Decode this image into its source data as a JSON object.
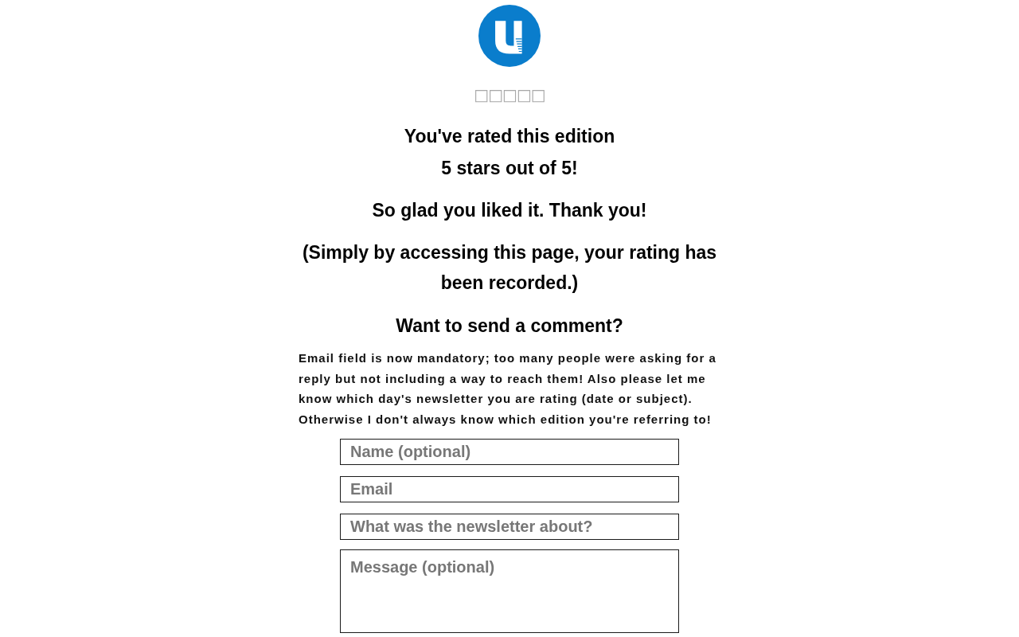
{
  "rating_marks": "□□□□□",
  "confirmation": {
    "title": "You've rated this edition\n5 stars out of 5!",
    "thanks": "So glad you liked it. Thank you!",
    "note": "(Simply by accessing this page, your rating has been recorded.)"
  },
  "comment_form": {
    "title": "Want to send a comment?",
    "notice": "Email field is now mandatory; too many people were asking for a reply but not including a way to reach them! Also please let me know which day's newsletter you are rating (date or subject). Otherwise I don't always know which edition you're referring to!",
    "fields": [
      {
        "kind": "input",
        "placeholder": "Name (optional)"
      },
      {
        "kind": "input",
        "placeholder": "Email"
      },
      {
        "kind": "input",
        "placeholder": "What was the newsletter about?"
      },
      {
        "kind": "textarea",
        "placeholder": "Message (optional)"
      }
    ]
  }
}
